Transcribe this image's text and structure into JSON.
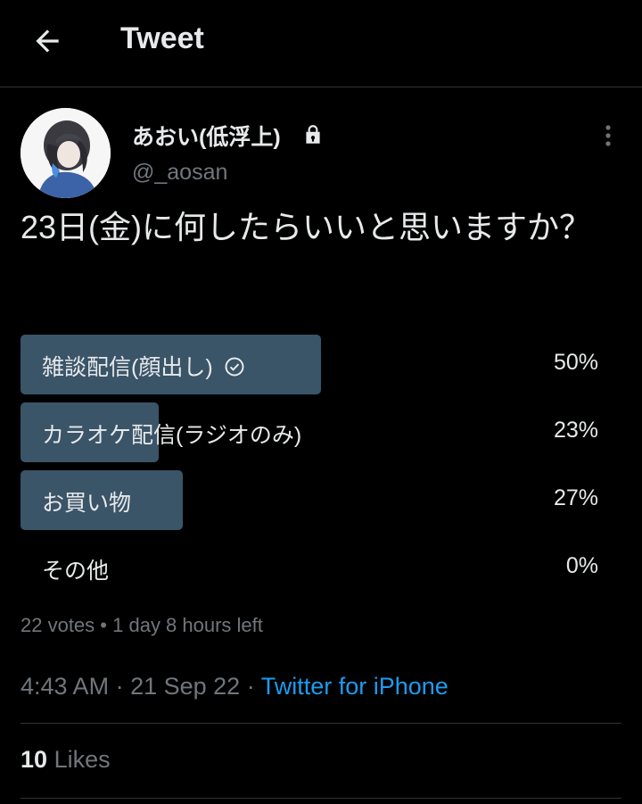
{
  "header": {
    "title": "Tweet",
    "back_icon": "arrow-left-icon"
  },
  "author": {
    "name": "あおい(低浮上)",
    "handle": "@_aosan",
    "protected": true,
    "lock_icon": "lock-icon"
  },
  "tweet": {
    "text": "23日(金)に何したらいいと思いますか？"
  },
  "poll": {
    "options": [
      {
        "label": "雑談配信(顔出し)",
        "percent": "50%",
        "fraction": 0.5,
        "winner": true
      },
      {
        "label": "カラオケ配信(ラジオのみ)",
        "percent": "23%",
        "fraction": 0.23,
        "winner": false
      },
      {
        "label": "お買い物",
        "percent": "27%",
        "fraction": 0.27,
        "winner": false
      },
      {
        "label": "その他",
        "percent": "0%",
        "fraction": 0,
        "winner": false
      }
    ],
    "votes": "22 votes",
    "separator": "•",
    "time_left": "1 day 8 hours left"
  },
  "meta": {
    "time": "4:43 AM",
    "date": "21 Sep 22",
    "source": "Twitter for iPhone",
    "dot": "·"
  },
  "stats": {
    "likes_count": "10",
    "likes_label": "Likes"
  },
  "colors": {
    "background": "#000000",
    "bar": "#3a5468",
    "link": "#1d9bf0",
    "muted": "#71767b"
  }
}
